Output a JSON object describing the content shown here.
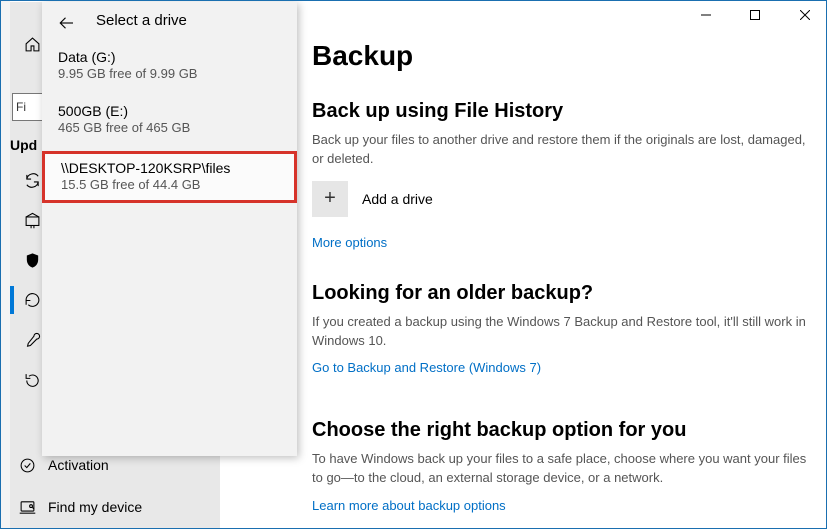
{
  "window": {
    "title": "Backup"
  },
  "flyout": {
    "title": "Select a drive",
    "drives": [
      {
        "name": "Data (G:)",
        "sub": "9.95 GB free of 9.99 GB"
      },
      {
        "name": "500GB (E:)",
        "sub": "465 GB free of 465 GB"
      },
      {
        "name": "\\\\DESKTOP-120KSRP\\files",
        "sub": "15.5 GB free of 44.4 GB"
      }
    ]
  },
  "left_peek": {
    "find_placeholder": "Fi",
    "upd_label": "Upd"
  },
  "sidebar_bottom": {
    "items": [
      {
        "icon": "activation",
        "label": "Activation"
      },
      {
        "icon": "find",
        "label": "Find my device"
      }
    ]
  },
  "main": {
    "page_title": "Backup",
    "filehistory": {
      "heading": "Back up using File History",
      "body": "Back up your files to another drive and restore them if the originals are lost, damaged, or deleted.",
      "add_label": "Add a drive",
      "more_options": "More options"
    },
    "older": {
      "heading": "Looking for an older backup?",
      "body": "If you created a backup using the Windows 7 Backup and Restore tool, it'll still work in Windows 10.",
      "link": "Go to Backup and Restore (Windows 7)"
    },
    "choose": {
      "heading": "Choose the right backup option for you",
      "body": "To have Windows back up your files to a safe place, choose where you want your files to go—to the cloud, an external storage device, or a network.",
      "link": "Learn more about backup options"
    }
  }
}
